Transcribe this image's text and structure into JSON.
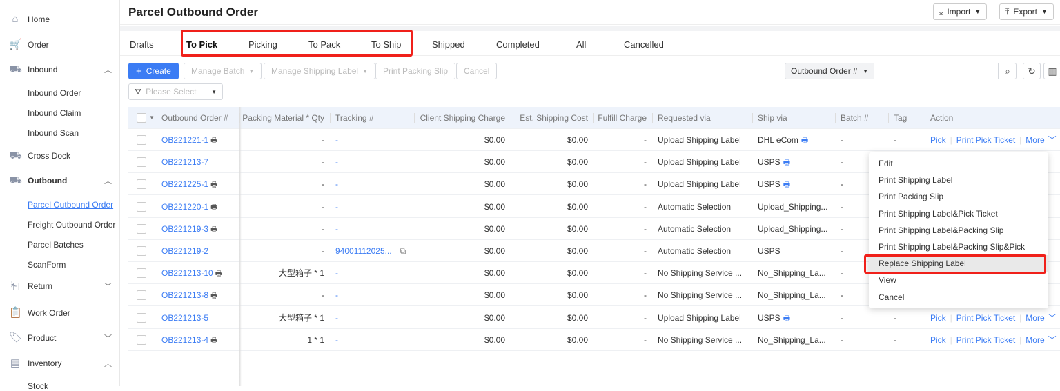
{
  "sidebar": {
    "items": [
      {
        "label": "Home",
        "icon": "home-icon",
        "glyph": "⌂"
      },
      {
        "label": "Order",
        "icon": "cart-icon",
        "glyph": "🛒"
      },
      {
        "label": "Inbound",
        "icon": "truck-icon",
        "glyph": "⛟",
        "chev": "^"
      },
      {
        "label": "Cross Dock",
        "icon": "cross-dock-icon",
        "glyph": "⛟"
      },
      {
        "label": "Outbound",
        "icon": "outbound-truck-icon",
        "glyph": "⛟",
        "chev": "^"
      },
      {
        "label": "Return",
        "icon": "return-icon",
        "glyph": "⎗",
        "chev": "v"
      },
      {
        "label": "Work Order",
        "icon": "clipboard-icon",
        "glyph": "📋"
      },
      {
        "label": "Product",
        "icon": "tag-icon",
        "glyph": "🏷",
        "chev": "v"
      },
      {
        "label": "Inventory",
        "icon": "inventory-icon",
        "glyph": "▤",
        "chev": "^"
      }
    ],
    "inbound_sub": [
      "Inbound Order",
      "Inbound Claim",
      "Inbound Scan"
    ],
    "outbound_sub": [
      "Parcel Outbound Order",
      "Freight Outbound Order",
      "Parcel Batches",
      "ScanForm"
    ],
    "inventory_sub": [
      "Stock"
    ]
  },
  "header": {
    "title": "Parcel Outbound Order",
    "import": "Import",
    "export": "Export"
  },
  "tabs": [
    "Drafts",
    "To Pick",
    "Picking",
    "To Pack",
    "To Ship",
    "Shipped",
    "Completed",
    "All",
    "Cancelled"
  ],
  "toolbar": {
    "create": "Create",
    "manage_batch": "Manage Batch",
    "manage_label": "Manage Shipping Label",
    "print_slip": "Print Packing Slip",
    "cancel": "Cancel",
    "filter_placeholder": "Please Select",
    "search_field": "Outbound Order #"
  },
  "columns": [
    "Outbound Order #",
    "Packing Material * Qty",
    "Tracking #",
    "Client Shipping Charge",
    "Est. Shipping Cost",
    "Fulfill Charge",
    "Requested via",
    "Ship via",
    "Batch #",
    "Tag",
    "Action"
  ],
  "rows": [
    {
      "order": "OB221221-1",
      "printer": true,
      "packing": "-",
      "tracking": "-",
      "client": "$0.00",
      "est": "$0.00",
      "fulfill": "-",
      "requested": "Upload Shipping Label",
      "ship": "DHL eCom",
      "shipicon": true,
      "batch": "-",
      "tag": "-"
    },
    {
      "order": "OB221213-7",
      "printer": false,
      "packing": "-",
      "tracking": "-",
      "client": "$0.00",
      "est": "$0.00",
      "fulfill": "-",
      "requested": "Upload Shipping Label",
      "ship": "USPS",
      "shipicon": true,
      "batch": "-",
      "tag": "-"
    },
    {
      "order": "OB221225-1",
      "printer": true,
      "packing": "-",
      "tracking": "-",
      "client": "$0.00",
      "est": "$0.00",
      "fulfill": "-",
      "requested": "Upload Shipping Label",
      "ship": "USPS",
      "shipicon": true,
      "batch": "-",
      "tag": "-"
    },
    {
      "order": "OB221220-1",
      "printer": true,
      "packing": "-",
      "tracking": "-",
      "client": "$0.00",
      "est": "$0.00",
      "fulfill": "-",
      "requested": "Automatic Selection",
      "ship": "Upload_Shipping...",
      "shipicon": false,
      "batch": "-",
      "tag": "-"
    },
    {
      "order": "OB221219-3",
      "printer": true,
      "packing": "-",
      "tracking": "-",
      "client": "$0.00",
      "est": "$0.00",
      "fulfill": "-",
      "requested": "Automatic Selection",
      "ship": "Upload_Shipping...",
      "shipicon": false,
      "batch": "-",
      "tag": "-"
    },
    {
      "order": "OB221219-2",
      "printer": false,
      "packing": "-",
      "tracking": "94001112025...",
      "copy": true,
      "client": "$0.00",
      "est": "$0.00",
      "fulfill": "-",
      "requested": "Automatic Selection",
      "ship": "USPS",
      "shipicon": false,
      "batch": "-",
      "tag": "-"
    },
    {
      "order": "OB221213-10",
      "printer": true,
      "packing": "大型箱子 * 1",
      "tracking": "-",
      "client": "$0.00",
      "est": "$0.00",
      "fulfill": "-",
      "requested": "No Shipping Service ...",
      "ship": "No_Shipping_La...",
      "shipicon": false,
      "batch": "-",
      "tag": "-"
    },
    {
      "order": "OB221213-8",
      "printer": true,
      "packing": "-",
      "tracking": "-",
      "client": "$0.00",
      "est": "$0.00",
      "fulfill": "-",
      "requested": "No Shipping Service ...",
      "ship": "No_Shipping_La...",
      "shipicon": false,
      "batch": "-",
      "tag": "-"
    },
    {
      "order": "OB221213-5",
      "printer": false,
      "packing": "大型箱子 * 1",
      "tracking": "-",
      "client": "$0.00",
      "est": "$0.00",
      "fulfill": "-",
      "requested": "Upload Shipping Label",
      "ship": "USPS",
      "shipicon": true,
      "batch": "-",
      "tag": "-"
    },
    {
      "order": "OB221213-4",
      "printer": true,
      "packing": "1 * 1",
      "tracking": "-",
      "client": "$0.00",
      "est": "$0.00",
      "fulfill": "-",
      "requested": "No Shipping Service ...",
      "ship": "No_Shipping_La...",
      "shipicon": false,
      "batch": "-",
      "tag": "-"
    }
  ],
  "actions": {
    "pick": "Pick",
    "print_pick": "Print Pick Ticket",
    "more": "More"
  },
  "visible_action_rows": [
    0,
    8,
    9
  ],
  "more_menu": [
    "Edit",
    "Print Shipping Label",
    "Print Packing Slip",
    "Print Shipping Label&Pick Ticket",
    "Print Shipping Label&Packing Slip",
    "Print Shipping Label&Packing Slip&Pick Ticket",
    "Replace Shipping Label",
    "View",
    "Cancel"
  ],
  "highlighted_menu_item": "Replace Shipping Label",
  "colors": {
    "accent": "#3b7cf4",
    "highlight_box": "#f0201a"
  }
}
